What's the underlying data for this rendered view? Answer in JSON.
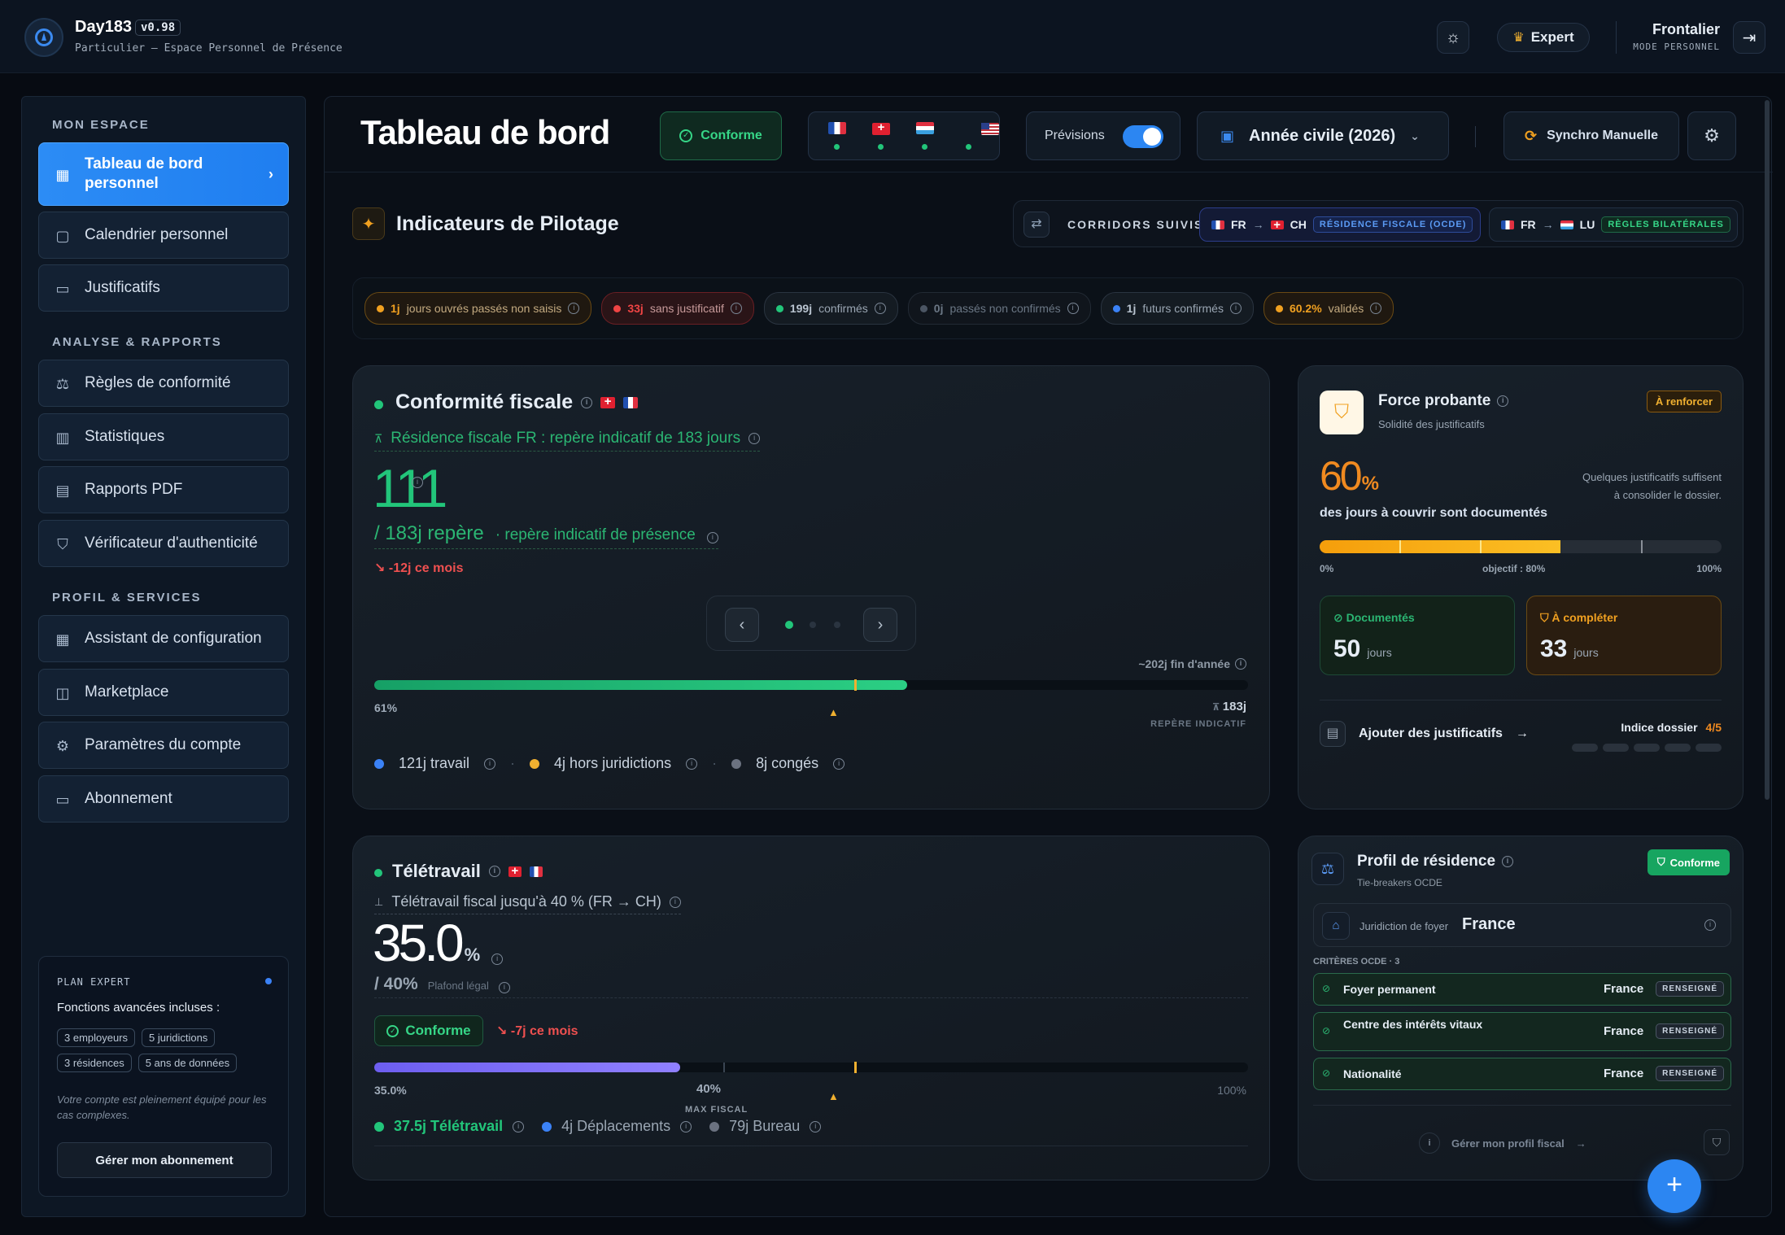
{
  "app": {
    "name": "Day183",
    "version": "v0.98",
    "subtitle": "Particulier — Espace Personnel de Présence",
    "expert_label": "Expert",
    "user_name": "Frontalier",
    "user_mode": "MODE PERSONNEL"
  },
  "sidebar": {
    "sec_espace": "MON ESPACE",
    "sec_analyse": "ANALYSE & RAPPORTS",
    "sec_profil": "PROFIL & SERVICES",
    "items": [
      "Tableau de bord personnel",
      "Calendrier personnel",
      "Justificatifs",
      "Règles de conformité",
      "Statistiques",
      "Rapports PDF",
      "Vérificateur d'authenticité",
      "Assistant de configuration",
      "Marketplace",
      "Paramètres du compte",
      "Abonnement"
    ],
    "plan": {
      "title": "PLAN EXPERT",
      "subtitle": "Fonctions avancées incluses :",
      "chips": [
        "3 employeurs",
        "5 juridictions",
        "3 résidences",
        "5 ans de données"
      ],
      "note": "Votre compte est pleinement équipé pour les cas complexes.",
      "button": "Gérer mon abonnement"
    }
  },
  "toolbar": {
    "title": "Tableau de bord",
    "conforme": "Conforme",
    "previsions": "Prévisions",
    "year": "Année civile (2026)",
    "sync": "Synchro Manuelle"
  },
  "pilotage": {
    "title": "Indicateurs de Pilotage",
    "corridors_label": "CORRIDORS SUIVIS",
    "corridor1": {
      "from": "FR",
      "to": "CH",
      "tag": "RÉSIDENCE FISCALE (OCDE)"
    },
    "corridor2": {
      "from": "FR",
      "to": "LU",
      "tag": "RÈGLES BILATÉRALES"
    },
    "stats": [
      {
        "value": "1j",
        "label": "jours ouvrés passés non saisis",
        "color": "#f0a020"
      },
      {
        "value": "33j",
        "label": "sans justificatif",
        "color": "#ef4444"
      },
      {
        "value": "199j",
        "label": "confirmés",
        "color": "#22c57a"
      },
      {
        "value": "0j",
        "label": "passés non confirmés",
        "color": "#4b5563"
      },
      {
        "value": "1j",
        "label": "futurs confirmés",
        "color": "#3b82f6"
      },
      {
        "value": "60.2%",
        "label": "validés",
        "color": "#f0a020"
      }
    ]
  },
  "fiscal": {
    "title": "Conformité fiscale",
    "subtitle": "Résidence fiscale FR : repère indicatif de 183 jours",
    "big": "111",
    "repere": "/ 183j repère",
    "repere_desc": "· repère indicatif de présence",
    "delta": "-12j ce mois",
    "forecast": "~202j fin d'année",
    "pct": "61%",
    "target": "183j",
    "target_label": "REPÈRE INDICATIF",
    "progress": 0.61,
    "legend": [
      "121j travail",
      "4j hors juridictions",
      "8j congés"
    ]
  },
  "teletravail": {
    "title": "Télétravail",
    "subtitle": "Télétravail fiscal jusqu'à 40 % (FR → CH)",
    "big": "35.0",
    "unit": "%",
    "plafond": "/ 40%",
    "plafond_label": "Plafond légal",
    "conforme": "Conforme",
    "delta": "-7j ce mois",
    "progress": 0.35,
    "left": "35.0%",
    "mid": "40%",
    "mid_label": "MAX FISCAL",
    "right": "100%",
    "legend": [
      "37.5j Télétravail",
      "4j Déplacements",
      "79j Bureau"
    ]
  },
  "force": {
    "title": "Force probante",
    "subtitle": "Solidité des justificatifs",
    "badge": "À renforcer",
    "pct": "60",
    "unit": "%",
    "desc": "des jours à couvrir sont documentés",
    "note": "Quelques justificatifs suffisent à consolider le dossier.",
    "progress": 0.6,
    "scale_left": "0%",
    "scale_mid": "objectif : 80%",
    "scale_right": "100%",
    "doc_label": "Documentés",
    "doc_value": "50",
    "doc_unit": "jours",
    "comp_label": "À compléter",
    "comp_value": "33",
    "comp_unit": "jours",
    "add": "Ajouter des justificatifs",
    "indice_label": "Indice dossier",
    "indice_value": "4/5"
  },
  "profil": {
    "title": "Profil de résidence",
    "subtitle": "Tie-breakers OCDE",
    "badge": "Conforme",
    "jur_label": "Juridiction de foyer",
    "jur_value": "France",
    "crit_label": "CRITÈRES OCDE · 3",
    "criteria": [
      {
        "label": "Foyer permanent",
        "value": "France",
        "tag": "RENSEIGNÉ"
      },
      {
        "label": "Centre des intérêts vitaux",
        "value": "France",
        "tag": "RENSEIGNÉ"
      },
      {
        "label": "Nationalité",
        "value": "France",
        "tag": "RENSEIGNÉ"
      }
    ],
    "manage": "Gérer mon profil fiscal"
  }
}
